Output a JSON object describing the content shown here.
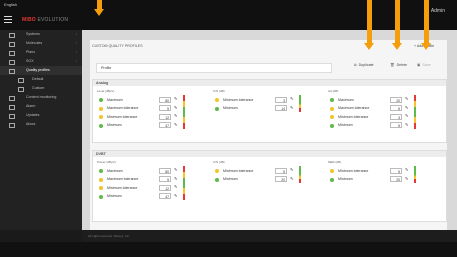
{
  "topbar": {
    "language": "English",
    "brand_main": "MIBO",
    "brand_sub": "EVOLUTION",
    "user": "Admin"
  },
  "sidebar": {
    "items": [
      {
        "label": "Systems",
        "active": false,
        "sub": false
      },
      {
        "label": "Molecules",
        "active": false,
        "sub": false
      },
      {
        "label": "Plans",
        "active": false,
        "sub": false
      },
      {
        "label": "SOX",
        "active": false,
        "sub": false
      },
      {
        "label": "Quality profiles",
        "active": true,
        "sub": false
      },
      {
        "label": "Default",
        "active": false,
        "sub": true
      },
      {
        "label": "Custom",
        "active": false,
        "sub": true
      },
      {
        "label": "Content monitoring",
        "active": false,
        "sub": false
      },
      {
        "label": "Alarm",
        "active": false,
        "sub": false
      },
      {
        "label": "Updates",
        "active": false,
        "sub": false
      },
      {
        "label": "About",
        "active": false,
        "sub": false
      }
    ]
  },
  "main": {
    "breadcrumb": "CUSTOM QUALITY PROFILES",
    "profile_name": "Profile",
    "buttons": {
      "duplicate": "Duplicate",
      "delete": "Delete",
      "save": "Save",
      "new": "+ Add profile"
    },
    "footer": "All rights reserved. Sitesys, Inc."
  },
  "sections": [
    {
      "title": "Analog",
      "columns": [
        {
          "title": "Level (dBµV)",
          "rows": [
            {
              "label": "Maximum",
              "value": "80",
              "dot": "g"
            },
            {
              "label": "Maximum tolerance",
              "value": "5",
              "dot": "y"
            },
            {
              "label": "Minimum tolerance",
              "value": "12",
              "dot": "y"
            },
            {
              "label": "Minimum",
              "value": "47",
              "dot": "g"
            }
          ]
        },
        {
          "title": "C/N (dB)",
          "rows": [
            {
              "label": "Minimum tolerance",
              "value": "3",
              "dot": "y"
            },
            {
              "label": "Minimum",
              "value": "14",
              "dot": "g"
            }
          ]
        },
        {
          "title": "AA (dB)",
          "rows": [
            {
              "label": "Maximum",
              "value": "20",
              "dot": "g"
            },
            {
              "label": "Maximum tolerance",
              "value": "5",
              "dot": "y"
            },
            {
              "label": "Minimum tolerance",
              "value": "3",
              "dot": "y"
            },
            {
              "label": "Minimum",
              "value": "5",
              "dot": "g"
            }
          ]
        }
      ]
    },
    {
      "title": "DVBT",
      "columns": [
        {
          "title": "Power (dBµV)",
          "rows": [
            {
              "label": "Maximum",
              "value": "80",
              "dot": "g"
            },
            {
              "label": "Maximum tolerance",
              "value": "5",
              "dot": "y"
            },
            {
              "label": "Minimum tolerance",
              "value": "12",
              "dot": "y"
            },
            {
              "label": "Minimum",
              "value": "47",
              "dot": "g"
            }
          ]
        },
        {
          "title": "C/N (dB)",
          "rows": [
            {
              "label": "Minimum tolerance",
              "value": "5",
              "dot": "y"
            },
            {
              "label": "Minimum",
              "value": "20",
              "dot": "g"
            }
          ]
        },
        {
          "title": "MER (dB)",
          "rows": [
            {
              "label": "Minimum tolerance",
              "value": "5",
              "dot": "y"
            },
            {
              "label": "Minimum",
              "value": "20",
              "dot": "g"
            }
          ]
        }
      ]
    }
  ],
  "colors": {
    "accent": "#f59e0b",
    "brand": "#e53935",
    "ok": "#5cbb4a",
    "warn": "#f6c32a",
    "alarm": "#e53935"
  },
  "icons": {
    "sidebar": "menu-icon",
    "edit": "pencil-icon",
    "duplicate": "copy-icon",
    "delete": "trash-icon",
    "save": "save-icon"
  }
}
